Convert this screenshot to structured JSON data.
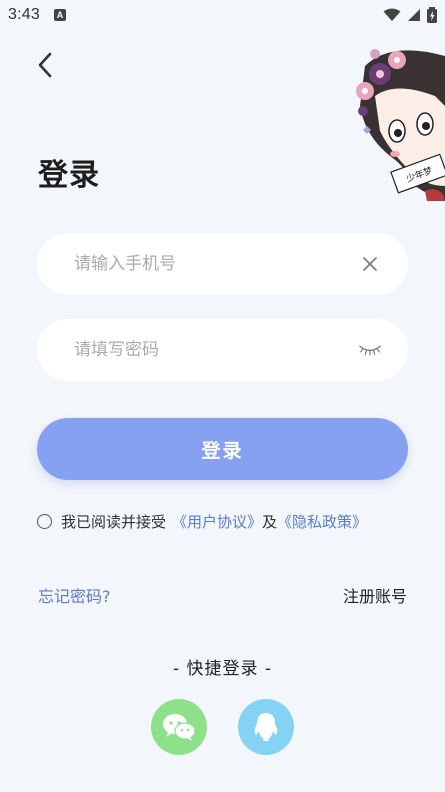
{
  "status_bar": {
    "time": "3:43",
    "notification_icon": "A"
  },
  "page": {
    "title": "登录"
  },
  "phone_field": {
    "placeholder": "请输入手机号"
  },
  "password_field": {
    "placeholder": "请填写密码"
  },
  "login_button": {
    "label": "登录"
  },
  "agreement": {
    "prefix": "我已阅读并接受",
    "user_agreement": "《用户协议》",
    "and": "及",
    "privacy_policy": "《隐私政策》"
  },
  "links": {
    "forgot_password": "忘记密码?",
    "register": "注册账号"
  },
  "quick_login": {
    "title": "- 快捷登录 -",
    "options": [
      "wechat-icon",
      "qq-icon"
    ]
  },
  "mascot": {
    "sign_text": "少年梦"
  },
  "colors": {
    "background": "#f3f6fa",
    "primary": "#86a0f2",
    "link": "#5b7bd0",
    "wechat": "#8ee08a",
    "qq": "#86d2f5"
  }
}
